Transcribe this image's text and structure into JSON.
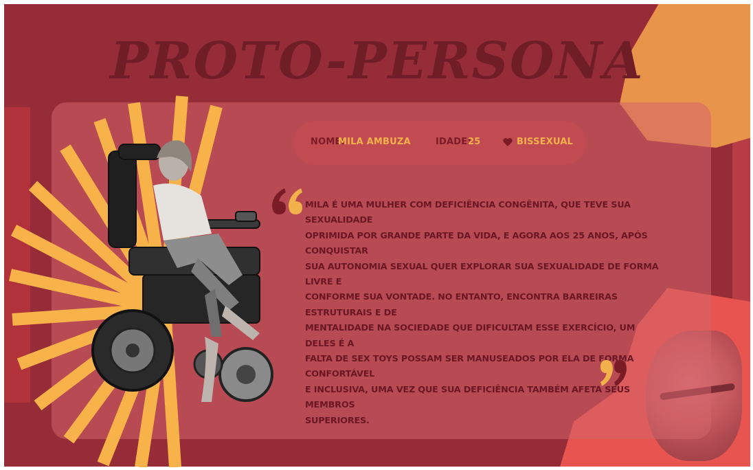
{
  "title": "PROTO-PERSONA",
  "info": {
    "name_label": "NOME:",
    "name_value": "MILA AMBUZA",
    "age_label": "IDADE:",
    "age_value": "25",
    "orientation_value": "BISSEXUAL"
  },
  "description_lines": [
    "MILA É UMA MULHER COM DEFICIÊNCIA CONGÊNITA,  QUE TEVE SUA SEXUALIDADE",
    "OPRIMIDA POR GRANDE PARTE DA VIDA, E AGORA AOS 25 ANOS, APÓS CONQUISTAR",
    "SUA AUTONOMIA SEXUAL QUER EXPLORAR SUA SEXUALIDADE DE FORMA LIVRE E",
    "CONFORME SUA VONTADE. NO ENTANTO, ENCONTRA BARREIRAS ESTRUTURAIS E DE",
    "MENTALIDADE NA SOCIEDADE QUE DIFICULTAM ESSE EXERCÍCIO, UM DELES É A",
    "FALTA DE SEX TOYS POSSAM SER MANUSEADOS POR ELA DE FORMA CONFORTÁVEL",
    "E INCLUSIVA, UMA VEZ QUE SUA DEFICIÊNCIA TAMBÉM AFETA SEUS MEMBROS",
    "SUPERIORES."
  ],
  "colors": {
    "background": "#962c37",
    "title": "#6f1e28",
    "accent_yellow": "#f2b14a",
    "accent_orange": "#e8944a",
    "accent_pink": "#e8544f",
    "text_dark": "#6a1723"
  },
  "icons": {
    "heart": "heart-icon",
    "quote_open": "quote-open-icon",
    "quote_close": "quote-close-icon"
  }
}
